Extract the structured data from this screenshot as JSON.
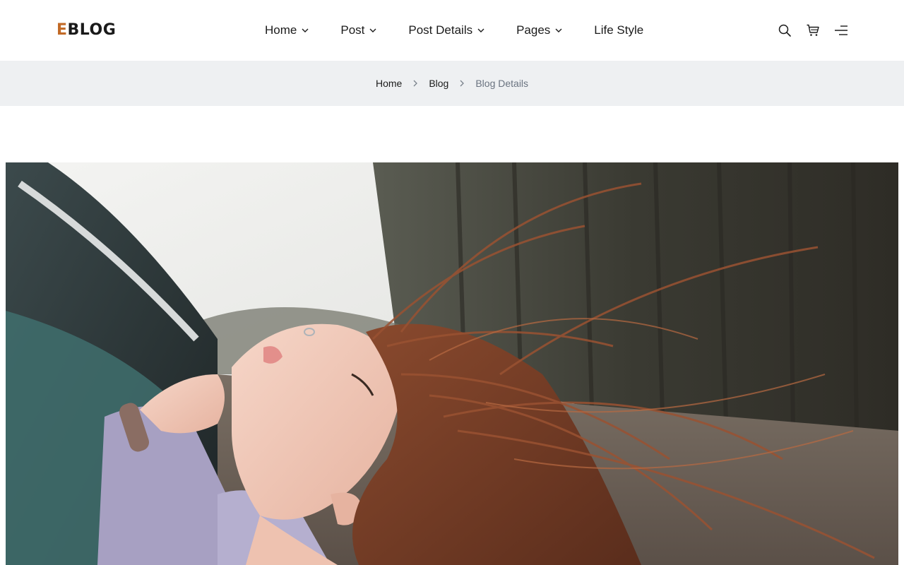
{
  "brand": {
    "logo_first": "E",
    "logo_rest": "BLOG",
    "accent": "#c26a26"
  },
  "nav": {
    "items": [
      {
        "label": "Home",
        "has_dropdown": true
      },
      {
        "label": "Post",
        "has_dropdown": true
      },
      {
        "label": "Post Details",
        "has_dropdown": true
      },
      {
        "label": "Pages",
        "has_dropdown": true
      },
      {
        "label": "Life Style",
        "has_dropdown": false
      }
    ]
  },
  "header_icons": [
    "search-icon",
    "cart-icon",
    "menu-icon"
  ],
  "breadcrumb": {
    "items": [
      "Home",
      "Blog"
    ],
    "current": "Blog Details",
    "background": "#eef0f2"
  },
  "hero": {
    "subject": "hero-photo"
  }
}
